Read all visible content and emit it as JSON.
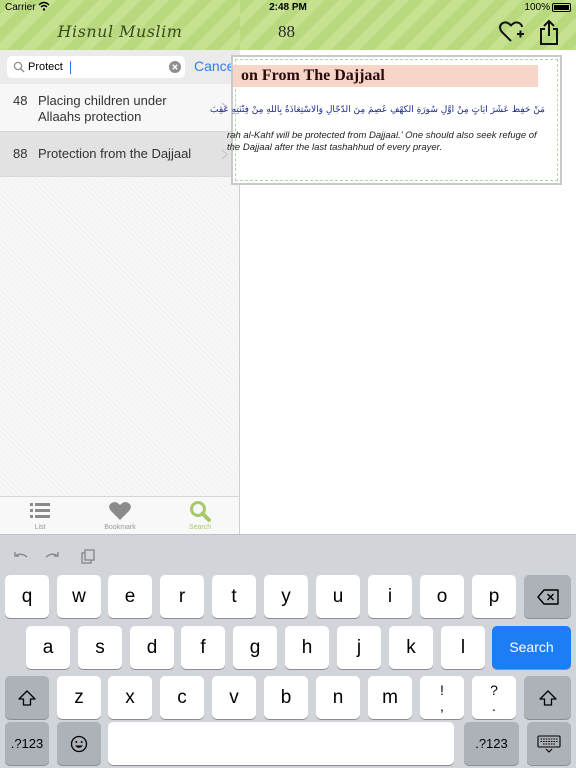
{
  "status_bar": {
    "carrier": "Carrier",
    "time": "2:48 PM",
    "battery": "100%"
  },
  "master": {
    "title": "Hisnul Muslim",
    "search": {
      "value": "Protect",
      "cancel_label": "Cancel"
    },
    "results": [
      {
        "number": "48",
        "label": "Placing children under Allaahs protection"
      },
      {
        "number": "88",
        "label": "Protection from the Dajjaal"
      }
    ],
    "tabs": [
      {
        "label": "List",
        "icon": "list-icon"
      },
      {
        "label": "Bookmark",
        "icon": "heart-icon"
      },
      {
        "label": "Search",
        "icon": "search-icon",
        "active": true
      }
    ]
  },
  "detail": {
    "number": "88",
    "heading": "on From The Dajjaal",
    "arabic": "مَنْ حَفِظَ عَشْرَ آيَاتٍ مِنْ أَوَّلِ سُورَةِ الْكَهْفِ عُصِمَ مِنَ الدَّجَّالِ وَالْاسْتِعَاذَةُ بِاللهِ مِنْ فِتْنَتِهِ عَقِبَ",
    "translation": "rah al-Kahf will be protected from Dajjaal.' One should also seek refuge of the Dajjaal after the last tashahhud of every prayer.",
    "actions": [
      "heart-plus-icon",
      "share-icon"
    ]
  },
  "keyboard": {
    "row1": [
      "q",
      "w",
      "e",
      "r",
      "t",
      "y",
      "u",
      "i",
      "o",
      "p"
    ],
    "row2": [
      "a",
      "s",
      "d",
      "f",
      "g",
      "h",
      "j",
      "k",
      "l"
    ],
    "row3": [
      "z",
      "x",
      "c",
      "v",
      "b",
      "n",
      "m"
    ],
    "punct1": {
      "top": "!",
      "bottom": ","
    },
    "punct2": {
      "top": "?",
      "bottom": "."
    },
    "search_label": "Search",
    "numbers_label": ".?123",
    "accent_color": "#1d7df5"
  },
  "colors": {
    "header_green": "#b8d97e",
    "heading_bg": "#f7d6c9",
    "link_blue": "#2d7bf6",
    "tab_active": "#a6c96b"
  }
}
